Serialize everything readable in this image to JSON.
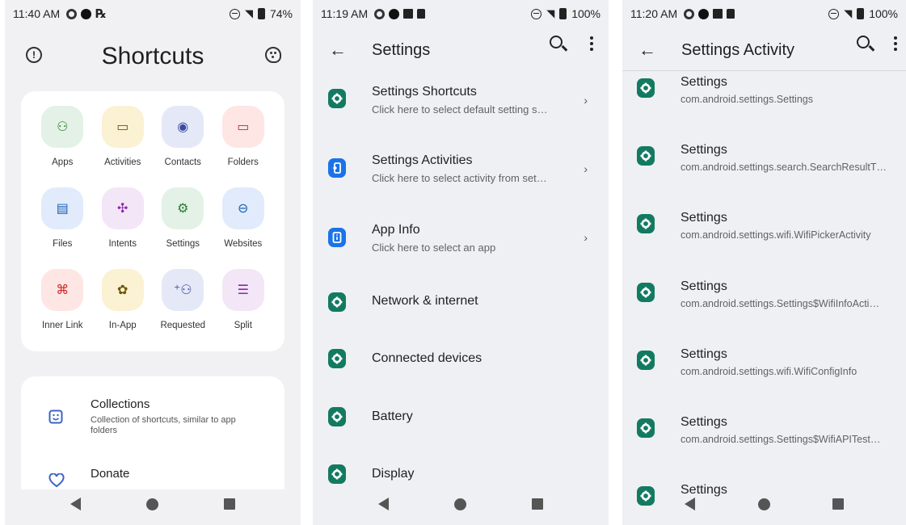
{
  "screen1": {
    "status": {
      "time": "11:40 AM",
      "battery": "74%"
    },
    "title": "Shortcuts",
    "grid": [
      {
        "label": "Apps",
        "icon": "android-icon",
        "glyph": "⚇",
        "bg": "#e3f1e6",
        "fg": "#2e7d32"
      },
      {
        "label": "Activities",
        "icon": "screen-icon",
        "glyph": "▭",
        "bg": "#fbf1d3",
        "fg": "#6d5400"
      },
      {
        "label": "Contacts",
        "icon": "contact-icon",
        "glyph": "◉",
        "bg": "#e5e8f7",
        "fg": "#3a4a9f"
      },
      {
        "label": "Folders",
        "icon": "folder-icon",
        "glyph": "▭",
        "bg": "#fde6e4",
        "fg": "#c62828"
      },
      {
        "label": "Files",
        "icon": "file-icon",
        "glyph": "▤",
        "bg": "#e1ebfb",
        "fg": "#1a5fb4"
      },
      {
        "label": "Intents",
        "icon": "intents-icon",
        "glyph": "✣",
        "bg": "#f3e6f7",
        "fg": "#8e24aa"
      },
      {
        "label": "Settings",
        "icon": "gear-icon",
        "glyph": "⚙",
        "bg": "#e3f1e6",
        "fg": "#2e7d32"
      },
      {
        "label": "Websites",
        "icon": "link-icon",
        "glyph": "⊖",
        "bg": "#e1ebfb",
        "fg": "#1a5fb4"
      },
      {
        "label": "Inner Link",
        "icon": "command-icon",
        "glyph": "⌘",
        "bg": "#fde6e4",
        "fg": "#c62828"
      },
      {
        "label": "In-App",
        "icon": "puzzle-icon",
        "glyph": "✿",
        "bg": "#fbf1d3",
        "fg": "#6d5400"
      },
      {
        "label": "Requested",
        "icon": "person-add-icon",
        "glyph": "⁺⚇",
        "bg": "#e5e8f7",
        "fg": "#3a4a9f"
      },
      {
        "label": "Split",
        "icon": "split-icon",
        "glyph": "☰",
        "bg": "#f3e6f7",
        "fg": "#8e24aa"
      }
    ],
    "list": [
      {
        "title": "Collections",
        "subtitle": "Collection of shortcuts, similar to app folders",
        "icon": "sticker-icon"
      },
      {
        "title": "Donate",
        "subtitle": "",
        "icon": "heart-icon"
      }
    ]
  },
  "screen2": {
    "status": {
      "time": "11:19 AM",
      "battery": "100%"
    },
    "title": "Settings",
    "items": [
      {
        "title": "Settings Shortcuts",
        "subtitle": "Click here to select default setting s…",
        "chevron": "›",
        "color": "green",
        "icon": "settings-icon"
      },
      {
        "title": "Settings Activities",
        "subtitle": "Click here to select activity from set…",
        "chevron": "›",
        "color": "blue",
        "icon": "activity-icon"
      },
      {
        "title": "App Info",
        "subtitle": "Click here to select an app",
        "chevron": "›",
        "color": "blue",
        "icon": "info-icon"
      },
      {
        "title": "Network & internet",
        "subtitle": "",
        "chevron": "",
        "color": "green",
        "icon": "settings-icon"
      },
      {
        "title": "Connected devices",
        "subtitle": "",
        "chevron": "",
        "color": "green",
        "icon": "settings-icon"
      },
      {
        "title": "Battery",
        "subtitle": "",
        "chevron": "",
        "color": "green",
        "icon": "settings-icon"
      },
      {
        "title": "Display",
        "subtitle": "",
        "chevron": "",
        "color": "green",
        "icon": "settings-icon"
      }
    ]
  },
  "screen3": {
    "status": {
      "time": "11:20 AM",
      "battery": "100%"
    },
    "title": "Settings Activity",
    "items": [
      {
        "title": "Settings",
        "subtitle": "com.android.settings.Settings"
      },
      {
        "title": "Settings",
        "subtitle": "com.android.settings.search.SearchResultT…"
      },
      {
        "title": "Settings",
        "subtitle": "com.android.settings.wifi.WifiPickerActivity"
      },
      {
        "title": "Settings",
        "subtitle": "com.android.settings.Settings$WifiInfoActi…"
      },
      {
        "title": "Settings",
        "subtitle": "com.android.settings.wifi.WifiConfigInfo"
      },
      {
        "title": "Settings",
        "subtitle": "com.android.settings.Settings$WifiAPITest…"
      },
      {
        "title": "Settings",
        "subtitle": ""
      }
    ]
  }
}
